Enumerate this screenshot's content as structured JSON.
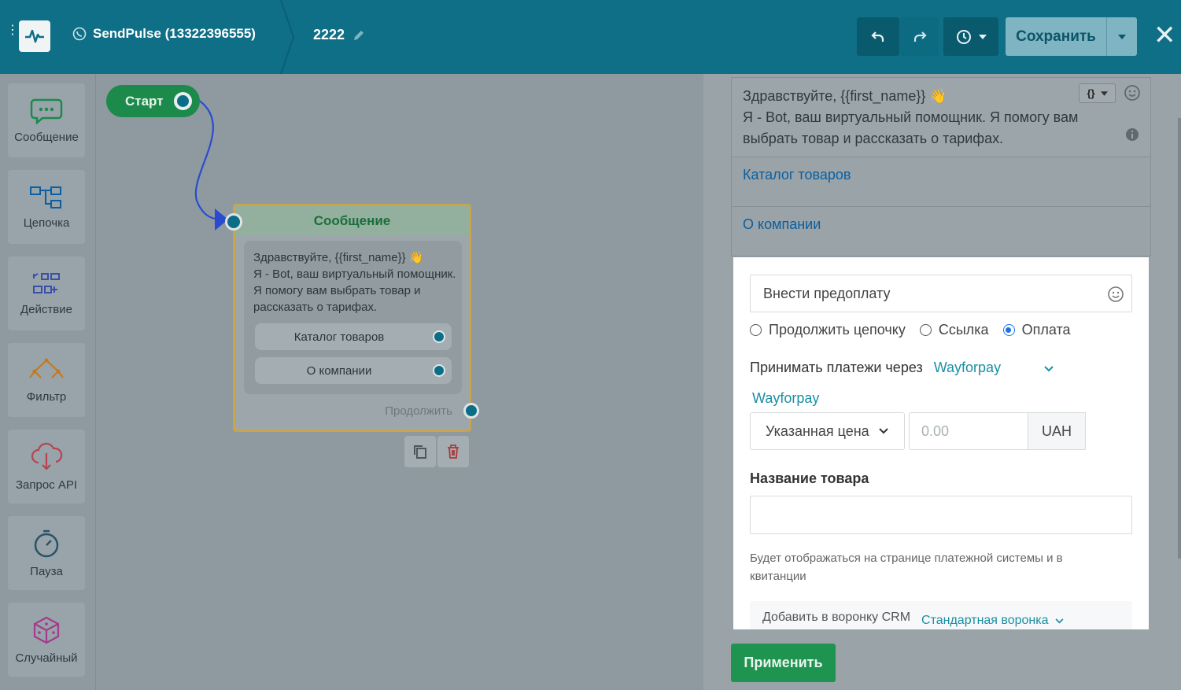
{
  "header": {
    "bot_name": "SendPulse (13322396555)",
    "flow_name": "2222",
    "save_label": "Сохранить",
    "icons": [
      "menu-dots-icon",
      "logo-icon",
      "whatsapp-icon",
      "edit-pencil-icon",
      "undo-icon",
      "redo-icon",
      "history-icon",
      "caret-down-icon",
      "close-icon"
    ]
  },
  "sidebar": {
    "items": [
      {
        "label": "Сообщение",
        "icon": "chat-bubble-icon",
        "color": "#1c8a4a"
      },
      {
        "label": "Цепочка",
        "icon": "chain-icon",
        "color": "#0b5fa0"
      },
      {
        "label": "Действие",
        "icon": "action-icon",
        "color": "#3b4fa8"
      },
      {
        "label": "Фильтр",
        "icon": "filter-icon",
        "color": "#c47a1a"
      },
      {
        "label": "Запрос API",
        "icon": "cloud-api-icon",
        "color": "#b8434f"
      },
      {
        "label": "Пауза",
        "icon": "timer-icon",
        "color": "#27536b"
      },
      {
        "label": "Случайный",
        "icon": "dice-icon",
        "color": "#a43a8e"
      }
    ]
  },
  "canvas": {
    "start_label": "Старт",
    "message_node": {
      "title": "Сообщение",
      "text_line1": "Здравствуйте,  {{first_name}} 👋",
      "text_rest": "Я - Bot, ваш виртуальный помощник. Я помогу вам выбрать товар и рассказать о тарифах.",
      "buttons": [
        "Каталог товаров",
        "О компании"
      ],
      "continue_label": "Продолжить"
    }
  },
  "panel": {
    "message_line1": "Здравствуйте,  {{first_name}} 👋",
    "message_rest": "Я - Bot, ваш виртуальный помощник. Я помогу вам выбрать товар и рассказать о тарифах.",
    "var_button": "{}",
    "links": [
      "Каталог товаров",
      "О компании"
    ],
    "button_editor": {
      "button_text": "Внести предоплату",
      "radio_options": [
        "Продолжить цепочку",
        "Ссылка",
        "Оплата"
      ],
      "selected_radio": "Оплата",
      "pay_via_label": "Принимать платежи через",
      "provider": "Wayforpay",
      "provider_link": "Wayforpay",
      "price_type": "Указанная цена",
      "price_placeholder": "0.00",
      "currency": "UAH",
      "product_label": "Название товара",
      "product_value": "",
      "hint": "Будет отображаться на странице платежной системы и в квитанции",
      "crm_label": "Добавить в воронку CRM",
      "crm_funnel": "Стандартная воронка"
    },
    "apply_label": "Применить"
  },
  "colors": {
    "topbar": "#0e6f86",
    "accent_green": "#1f9450",
    "link_blue": "#0b5fa0",
    "teal": "#1a8fa3"
  }
}
